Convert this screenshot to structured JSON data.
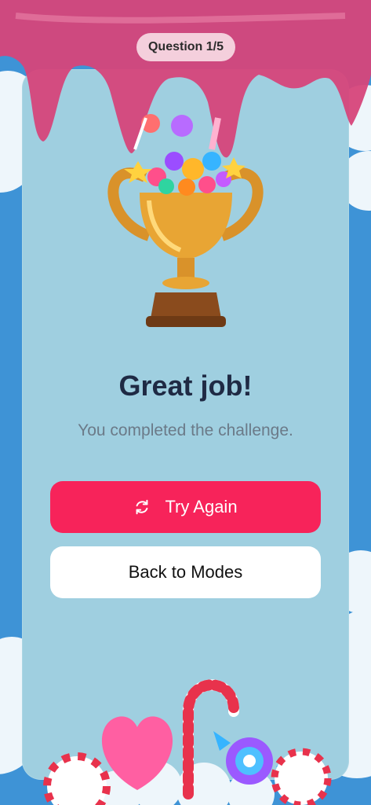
{
  "header": {
    "progress_label": "Question 1/5"
  },
  "result": {
    "title": "Great job!",
    "subtitle": "You completed the challenge."
  },
  "actions": {
    "try_again_label": "Try Again",
    "back_label": "Back to Modes"
  },
  "icons": {
    "retry": "refresh-icon",
    "trophy": "trophy-icon"
  },
  "colors": {
    "background": "#3e93d6",
    "card": "#9fcfe0",
    "primary_button": "#f7235a",
    "drip": "#d6457a",
    "title": "#1f2a44"
  }
}
